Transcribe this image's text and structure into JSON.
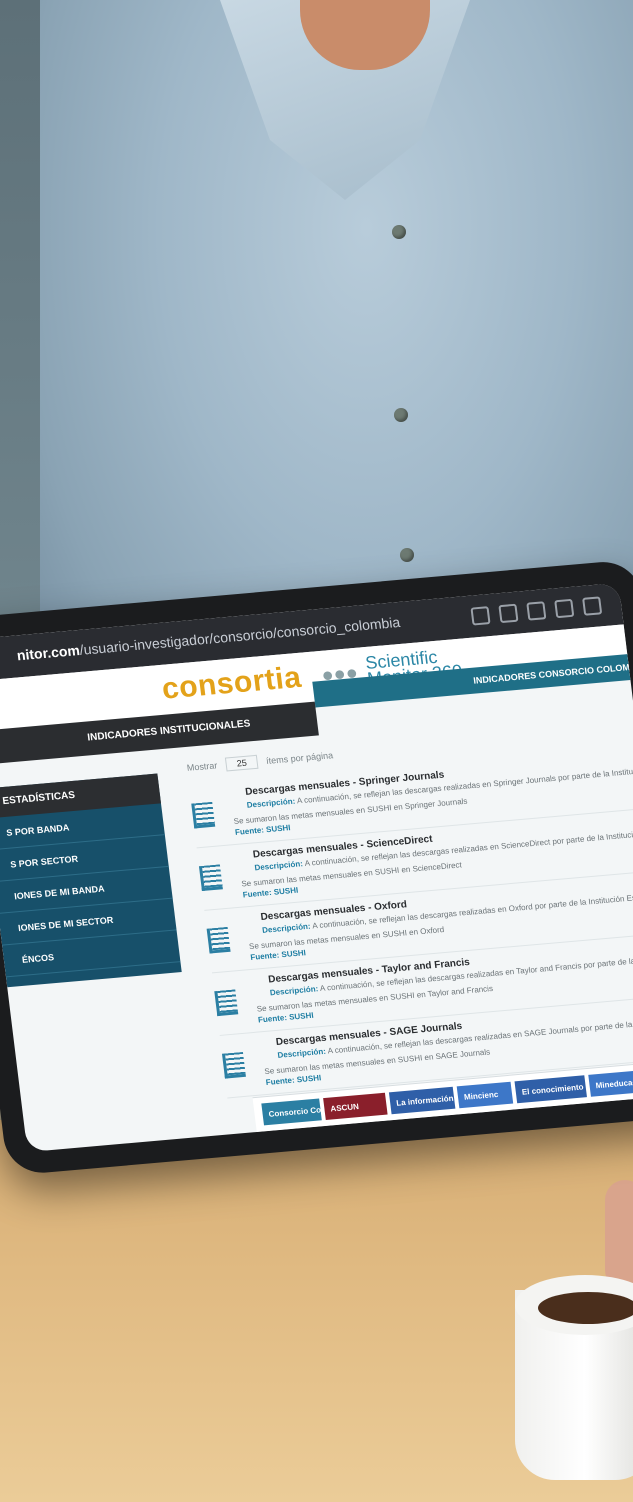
{
  "scene": {
    "colors": {
      "shirt": "#9fb7c8",
      "table": "#d6ad74",
      "tablet_bezel": "#1b1c1e",
      "brand_teal": "#1f6f87",
      "brand_orange": "#e3a21a"
    }
  },
  "browser": {
    "url_bold": "nitor.com",
    "url_rest": "/usuario-investigador/consorcio/consorcio_colombia",
    "icons": [
      "tabs-icon",
      "share-icon",
      "search-icon",
      "menu-icon",
      "settings-icon"
    ]
  },
  "site": {
    "logo_text": "consortia",
    "sci_line1": "Scientific",
    "sci_line2": "Monitor 360",
    "top_band": "INDICADORES CONSORCIO COLOMBIA",
    "nav_band": "INDICADORES INSTITUCIONALES"
  },
  "sidebar": {
    "header": "ESTADÍSTICAS",
    "items": [
      {
        "label": "S POR BANDA"
      },
      {
        "label": "S POR SECTOR"
      },
      {
        "label": "IONES DE MI BANDA"
      },
      {
        "label": "IONES DE MI SECTOR"
      },
      {
        "label": "ÉNCOS"
      }
    ]
  },
  "list_controls": {
    "show_label": "Mostrar",
    "page_size": "25",
    "per_page_label": "ítems por página"
  },
  "entries": [
    {
      "title": "Descargas mensuales - Springer Journals",
      "desc_label": "Descripción:",
      "desc": " A continuación, se reflejan las descargas realizadas en Springer Journals por parte de la Institución Escuela Superior de Guerra.",
      "summary": "Se sumaron las metas mensuales en SUSHI en Springer Journals",
      "source": "Fuente: SUSHI"
    },
    {
      "title": "Descargas mensuales - ScienceDirect",
      "desc_label": "Descripción:",
      "desc": " A continuación, se reflejan las descargas realizadas en ScienceDirect por parte de la Institución Escuela Superior de Guerra.",
      "summary": "Se sumaron las metas mensuales en SUSHI en ScienceDirect",
      "source": "Fuente: SUSHI"
    },
    {
      "title": "Descargas mensuales - Oxford",
      "desc_label": "Descripción:",
      "desc": " A continuación, se reflejan las descargas realizadas en Oxford por parte de la Institución Escuela Superior de Guerra.",
      "summary": "Se sumaron las metas mensuales en SUSHI en Oxford",
      "source": "Fuente: SUSHI"
    },
    {
      "title": "Descargas mensuales - Taylor and Francis",
      "desc_label": "Descripción:",
      "desc": " A continuación, se reflejan las descargas realizadas en Taylor and Francis por parte de la Institución Escuela Superior de Guerra.",
      "summary": "Se sumaron las metas mensuales en SUSHI en Taylor and Francis",
      "source": "Fuente: SUSHI"
    },
    {
      "title": "Descargas mensuales - SAGE Journals",
      "desc_label": "Descripción:",
      "desc": " A continuación, se reflejan las descargas realizadas en SAGE Journals por parte de la Institución Escuela Superior de Guerra.",
      "summary": "Se sumaron las metas mensuales en SUSHI en SAGE Journals",
      "source": "Fuente: SUSHI"
    }
  ],
  "footer_logos": [
    {
      "text": "Consorcio Colombia",
      "color": "#2b7fa3"
    },
    {
      "text": "ASCUN",
      "color": "#8a1f2b"
    },
    {
      "text": "La información es de todos",
      "color": "#2f5fa8"
    },
    {
      "text": "Mincienc",
      "color": "#3d77c8"
    },
    {
      "text": "El conocimiento es de todos",
      "color": "#2f5fa8"
    },
    {
      "text": "Mineducac",
      "color": "#3d77c8"
    }
  ]
}
